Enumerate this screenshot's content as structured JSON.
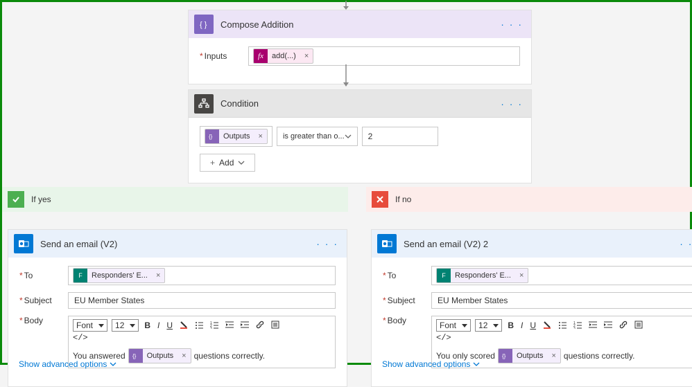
{
  "compose": {
    "title": "Compose Addition",
    "input_label": "Inputs",
    "token": {
      "icon": "fx",
      "text": "add(...)"
    }
  },
  "condition": {
    "title": "Condition",
    "left_token": {
      "text": "Outputs"
    },
    "operator": "is greater than o...",
    "value": "2",
    "add_label": "Add"
  },
  "branches": {
    "yes_label": "If yes",
    "no_label": "If no",
    "yes_action": {
      "title": "Send an email (V2)",
      "to_label": "To",
      "subject_label": "Subject",
      "body_label": "Body",
      "to_token": "Responders' E...",
      "subject": "EU Member States",
      "rte": {
        "font_label": "Font",
        "size_label": "12"
      },
      "body_before": "You answered",
      "body_token": "Outputs",
      "body_after": "questions correctly.",
      "show_advanced": "Show advanced options"
    },
    "no_action": {
      "title": "Send an email (V2) 2",
      "to_label": "To",
      "subject_label": "Subject",
      "body_label": "Body",
      "to_token": "Responders' E...",
      "subject": "EU Member States",
      "rte": {
        "font_label": "Font",
        "size_label": "12"
      },
      "body_before": "You only scored",
      "body_token": "Outputs",
      "body_after": "questions correctly.",
      "show_advanced": "Show advanced options"
    }
  }
}
